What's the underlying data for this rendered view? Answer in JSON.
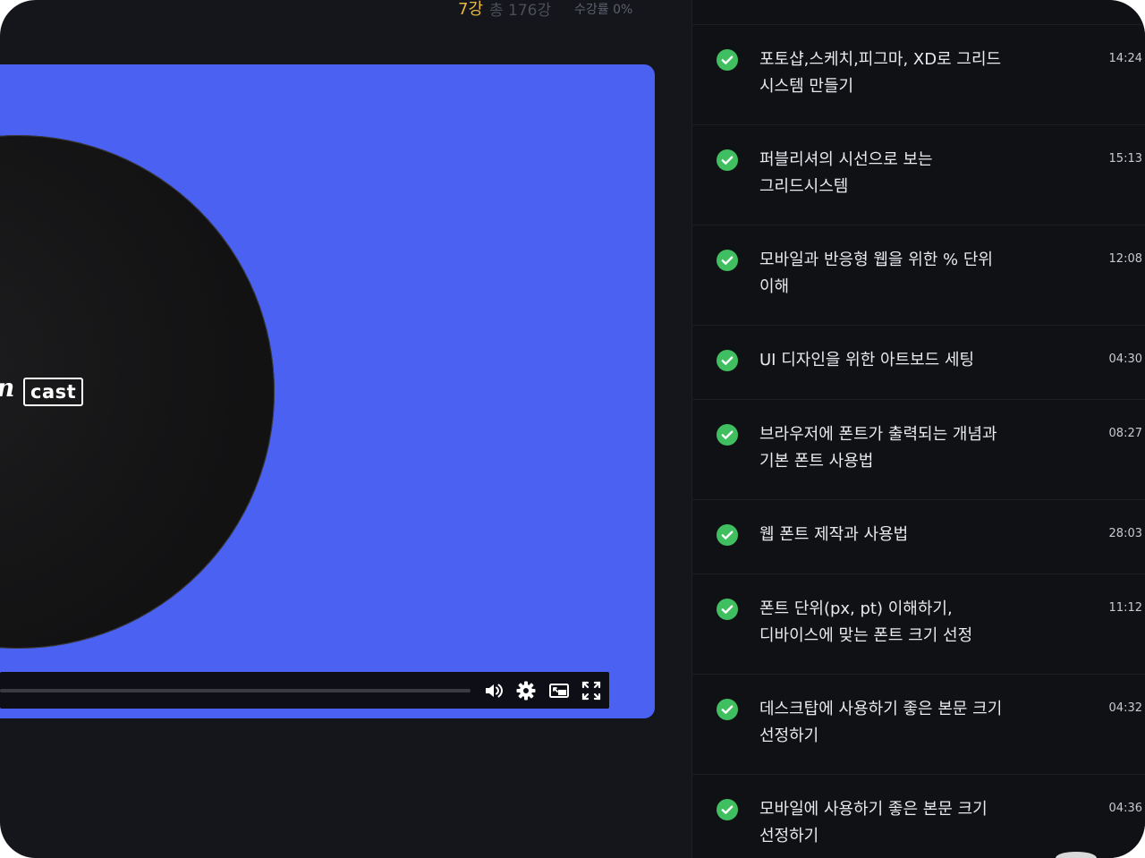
{
  "header": {
    "current_lesson": "7강",
    "total_lessons": "총 176강",
    "completion": "수강률 0%"
  },
  "video": {
    "logo_partial": "n",
    "logo_text": "cast",
    "progress": 0,
    "controls": [
      "volume-icon",
      "settings-gear-icon",
      "picture-in-picture-icon",
      "fullscreen-icon"
    ]
  },
  "lessons": [
    {
      "title": "포토샵,스케치,피그마, XD로 그리드 시스템 만들기",
      "duration": "14:24",
      "completed": true
    },
    {
      "title": "퍼블리셔의 시선으로 보는 그리드시스템",
      "duration": "15:13",
      "completed": true
    },
    {
      "title": "모바일과 반응형 웹을 위한 % 단위 이해",
      "duration": "12:08",
      "completed": true
    },
    {
      "title": "UI 디자인을 위한 아트보드 세팅",
      "duration": "04:30",
      "completed": true
    },
    {
      "title": "브라우저에 폰트가 출력되는 개념과 기본 폰트 사용법",
      "duration": "08:27",
      "completed": true
    },
    {
      "title": "웹 폰트 제작과 사용법",
      "duration": "28:03",
      "completed": true
    },
    {
      "title": "폰트 단위(px, pt) 이해하기, 디바이스에 맞는 폰트 크기 선정",
      "duration": "11:12",
      "completed": true
    },
    {
      "title": "데스크탑에 사용하기 좋은 본문 크기 선정하기",
      "duration": "04:32",
      "completed": true
    },
    {
      "title": "모바일에 사용하기 좋은 본문 크기 선정하기",
      "duration": "04:36",
      "completed": true
    }
  ],
  "colors": {
    "background": "#15161b",
    "sidebar": "#101115",
    "video_bg": "#4a61f2",
    "check": "#3fbf5f",
    "accent_lesson": "#e8b93c"
  }
}
